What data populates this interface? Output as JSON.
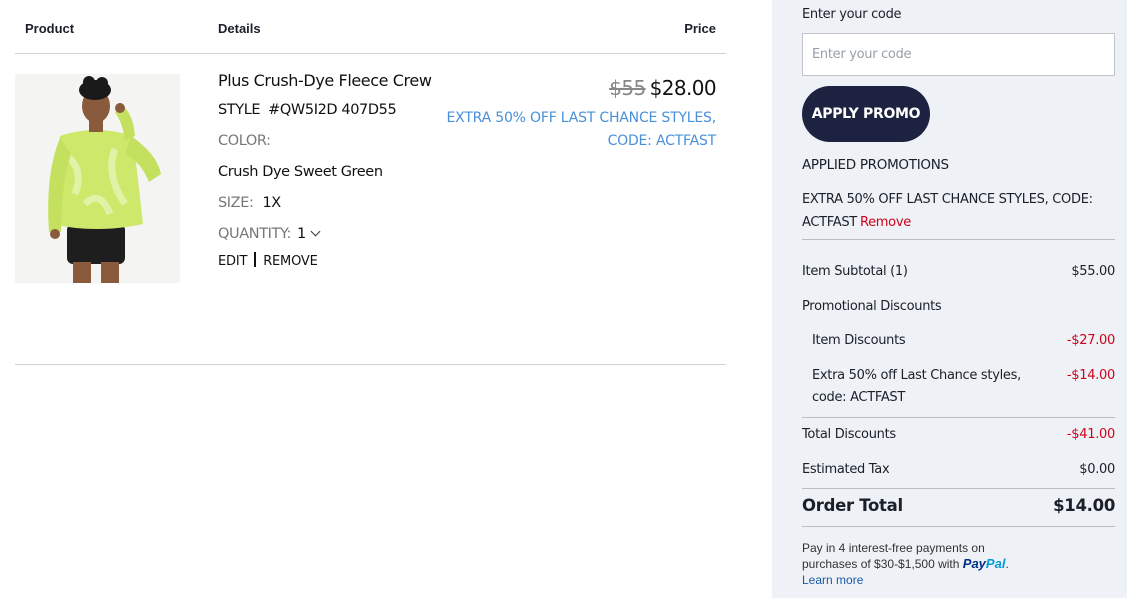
{
  "table_headers": {
    "product": "Product",
    "details": "Details",
    "price": "Price"
  },
  "item": {
    "name": "Plus Crush-Dye Fleece Crew",
    "style_label": "STYLE",
    "style_value": "#QW5I2D 407D55",
    "color_label": "COLOR:",
    "color_value": "Crush Dye Sweet Green",
    "size_label": "SIZE:",
    "size_value": "1X",
    "quantity_label": "QUANTITY:",
    "quantity_value": "1",
    "edit_label": "EDIT",
    "remove_label": "REMOVE",
    "original_price": "$55",
    "sale_price": "$28.00",
    "promo_line1": "EXTRA 50% OFF LAST CHANCE STYLES,",
    "promo_line2": "CODE: ACTFAST"
  },
  "summary": {
    "code_label": "Enter your code",
    "code_placeholder": "Enter your code",
    "apply_label": "APPLY PROMO",
    "applied_title": "APPLIED PROMOTIONS",
    "applied_text": "EXTRA 50% OFF LAST CHANCE STYLES, CODE: ACTFAST",
    "applied_remove": "Remove",
    "subtotal_label": "Item Subtotal (1)",
    "subtotal_value": "$55.00",
    "promo_discounts_label": "Promotional Discounts",
    "item_discounts_label": "Item Discounts",
    "item_discounts_value": "-$27.00",
    "extra_discount_label": "Extra 50% off Last Chance styles, code: ACTFAST",
    "extra_discount_value": "-$14.00",
    "total_discounts_label": "Total Discounts",
    "total_discounts_value": "-$41.00",
    "tax_label": "Estimated Tax",
    "tax_value": "$0.00",
    "order_total_label": "Order Total",
    "order_total_value": "$14.00"
  },
  "paypal": {
    "text_line1": "Pay in 4 interest-free payments on",
    "text_line2": "purchases of $30-$1,500 with",
    "logo_pay": "Pay",
    "logo_pal": "Pal",
    "period": ".",
    "learn_more": "Learn more"
  },
  "colors": {
    "accent_navy": "#1c2240",
    "promo_blue": "#4a90d9",
    "discount_red": "#d0021b",
    "panel_bg": "#eef1f5",
    "garment_green": "#cde86a"
  }
}
